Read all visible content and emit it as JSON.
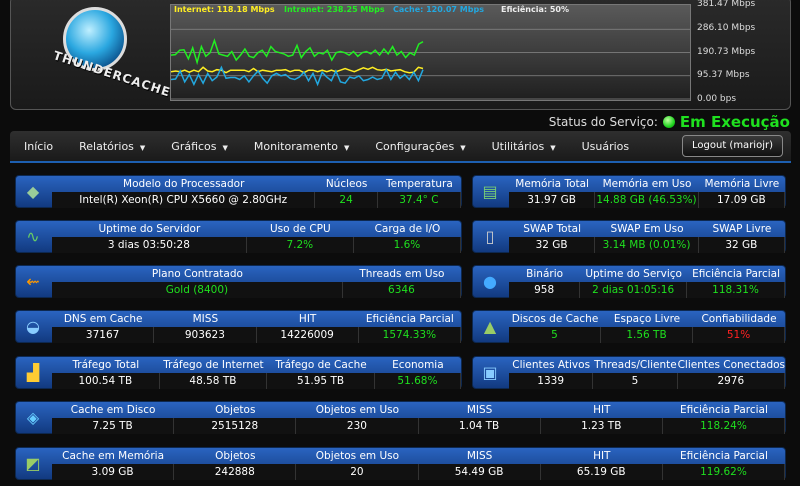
{
  "logo_text": "THUNDERCACHE",
  "chart_data": {
    "type": "line",
    "y_axis_labels": [
      "381.47 Mbps",
      "286.10 Mbps",
      "190.73 Mbps",
      "95.37 Mbps",
      "0.00 bps"
    ],
    "ylim": [
      0,
      381.47
    ],
    "legend": [
      {
        "label": "Internet: 118.18 Mbps",
        "color": "#ffee22"
      },
      {
        "label": "Intranet: 238.25 Mbps",
        "color": "#22ee22"
      },
      {
        "label": "Cache: 120.07 Mbps",
        "color": "#22a8e0"
      },
      {
        "label": "Eficiência: 50%",
        "color": "#eeeeee"
      }
    ],
    "series": [
      {
        "name": "Intranet",
        "color": "#22ee22",
        "values": [
          180,
          182,
          200,
          202,
          165,
          210,
          150,
          215,
          175,
          190,
          240,
          185,
          180,
          175,
          195,
          160,
          180,
          205,
          175,
          170,
          190,
          200,
          175,
          215,
          195,
          190,
          185,
          175,
          180,
          220,
          170,
          195,
          210,
          175,
          190,
          185,
          200,
          160,
          190,
          195,
          190,
          180,
          195,
          175,
          190,
          195,
          185,
          200,
          180,
          205,
          185,
          215,
          180,
          195,
          170,
          190,
          180,
          225,
          235
        ]
      },
      {
        "name": "Internet",
        "color": "#ffee22",
        "values": [
          112,
          115,
          112,
          118,
          110,
          118,
          112,
          130,
          115,
          112,
          120,
          118,
          108,
          118,
          118,
          118,
          118,
          112,
          125,
          112,
          118,
          115,
          112,
          118,
          118,
          120,
          112,
          118,
          118,
          108,
          118,
          118,
          112,
          118,
          112,
          118,
          112,
          118,
          125,
          118,
          112,
          120,
          128,
          122,
          130,
          120,
          118,
          122,
          115,
          118,
          120,
          112,
          108,
          110,
          130,
          125
        ]
      },
      {
        "name": "Cache",
        "color": "#22a8e0",
        "values": [
          80,
          82,
          115,
          70,
          100,
          60,
          100,
          65,
          105,
          75,
          90,
          130,
          85,
          88,
          88,
          80,
          95,
          70,
          95,
          115,
          85,
          65,
          95,
          105,
          95,
          100,
          85,
          80,
          90,
          110,
          75,
          105,
          60,
          110,
          90,
          75,
          115,
          70,
          65,
          90,
          85,
          95,
          75,
          80,
          90,
          80,
          85,
          120,
          80,
          110,
          85,
          100,
          80,
          110,
          75,
          120
        ]
      }
    ]
  },
  "status": {
    "label": "Status do Serviço:",
    "value": "Em Execução"
  },
  "nav": {
    "items": [
      "Início",
      "Relatórios",
      "Gráficos",
      "Monitoramento",
      "Configurações",
      "Utilitários",
      "Usuários"
    ],
    "logout": "Logout (mariojr)"
  },
  "panels": [
    {
      "icon": "◆",
      "cols": [
        {
          "h": "Modelo do Processador",
          "v": "Intel(R) Xeon(R) CPU X5660 @ 2.80GHz",
          "c": "w",
          "f": 3.8
        },
        {
          "h": "Núcleos",
          "v": "24",
          "c": "g",
          "f": 0.9
        },
        {
          "h": "Temperatura",
          "v": "37.4° C",
          "c": "g",
          "f": 1.2
        }
      ]
    },
    {
      "icon": "▤",
      "cols": [
        {
          "h": "Memória Total",
          "v": "31.97 GB",
          "c": "w",
          "f": 1
        },
        {
          "h": "Memória em Uso",
          "v": "14.88 GB (46.53%)",
          "c": "g",
          "f": 1.2
        },
        {
          "h": "Memória Livre",
          "v": "17.09 GB",
          "c": "w",
          "f": 1
        }
      ]
    },
    {
      "icon": "∿",
      "cols": [
        {
          "h": "Uptime do Servidor",
          "v": "3 dias 03:50:28",
          "c": "w",
          "f": 2
        },
        {
          "h": "Uso de CPU",
          "v": "7.2%",
          "c": "g",
          "f": 1.1
        },
        {
          "h": "Carga de I/O",
          "v": "1.6%",
          "c": "g",
          "f": 1.1
        }
      ]
    },
    {
      "icon": "▯",
      "cols": [
        {
          "h": "SWAP Total",
          "v": "32 GB",
          "c": "w",
          "f": 1
        },
        {
          "h": "SWAP Em Uso",
          "v": "3.14 MB (0.01%)",
          "c": "g",
          "f": 1.2
        },
        {
          "h": "SWAP Livre",
          "v": "32 GB",
          "c": "w",
          "f": 1
        }
      ]
    },
    {
      "icon": "⇜",
      "cols": [
        {
          "h": "Plano Contratado",
          "v": "Gold (8400)",
          "c": "g",
          "f": 3.2
        },
        {
          "h": "Threads em Uso",
          "v": "6346",
          "c": "g",
          "f": 1.3
        }
      ]
    },
    {
      "icon": "●",
      "cols": [
        {
          "h": "Binário",
          "v": "958",
          "c": "w",
          "f": 0.8
        },
        {
          "h": "Uptime do Serviço",
          "v": "2 dias 01:05:16",
          "c": "g",
          "f": 1.2
        },
        {
          "h": "Eficiência Parcial",
          "v": "118.31%",
          "c": "g",
          "f": 1.1
        }
      ]
    },
    {
      "icon": "◒",
      "cols": [
        {
          "h": "DNS em Cache",
          "v": "37167",
          "c": "w",
          "f": 1
        },
        {
          "h": "MISS",
          "v": "903623",
          "c": "w",
          "f": 1
        },
        {
          "h": "HIT",
          "v": "14226009",
          "c": "w",
          "f": 1
        },
        {
          "h": "Eficiência Parcial",
          "v": "1574.33%",
          "c": "g",
          "f": 1
        }
      ]
    },
    {
      "icon": "▲",
      "cols": [
        {
          "h": "Discos de Cache",
          "v": "5",
          "c": "g",
          "f": 1
        },
        {
          "h": "Espaço Livre",
          "v": "1.56 TB",
          "c": "g",
          "f": 1
        },
        {
          "h": "Confiabilidade",
          "v": "51%",
          "c": "r",
          "f": 1
        }
      ]
    },
    {
      "icon": "▟",
      "cols": [
        {
          "h": "Tráfego Total",
          "v": "100.54 TB",
          "c": "w",
          "f": 1
        },
        {
          "h": "Tráfego de Internet",
          "v": "48.58 TB",
          "c": "w",
          "f": 1
        },
        {
          "h": "Tráfego de Cache",
          "v": "51.95 TB",
          "c": "w",
          "f": 1
        },
        {
          "h": "Economia",
          "v": "51.68%",
          "c": "g",
          "f": 0.8
        }
      ]
    },
    {
      "icon": "▣",
      "cols": [
        {
          "h": "Clientes Ativos",
          "v": "1339",
          "c": "w",
          "f": 1
        },
        {
          "h": "Threads/Cliente",
          "v": "5",
          "c": "w",
          "f": 1
        },
        {
          "h": "Clientes Conectados",
          "v": "2976",
          "c": "w",
          "f": 1.2
        }
      ]
    },
    {
      "icon": "◈",
      "cols": [
        {
          "h": "Cache em Disco",
          "v": "7.25 TB",
          "c": "w",
          "f": 1
        },
        {
          "h": "Objetos",
          "v": "2515128",
          "c": "w",
          "f": 1
        },
        {
          "h": "Objetos em Uso",
          "v": "230",
          "c": "w",
          "f": 1
        },
        {
          "h": "MISS",
          "v": "1.04 TB",
          "c": "w",
          "f": 1
        },
        {
          "h": "HIT",
          "v": "1.23 TB",
          "c": "w",
          "f": 1
        },
        {
          "h": "Eficiência Parcial",
          "v": "118.24%",
          "c": "g",
          "f": 1
        }
      ]
    },
    {
      "icon": "◩",
      "cols": [
        {
          "h": "Cache em Memória",
          "v": "3.09 GB",
          "c": "w",
          "f": 1
        },
        {
          "h": "Objetos",
          "v": "242888",
          "c": "w",
          "f": 1
        },
        {
          "h": "Objetos em Uso",
          "v": "20",
          "c": "w",
          "f": 1
        },
        {
          "h": "MISS",
          "v": "54.49 GB",
          "c": "w",
          "f": 1
        },
        {
          "h": "HIT",
          "v": "65.19 GB",
          "c": "w",
          "f": 1
        },
        {
          "h": "Eficiência Parcial",
          "v": "119.62%",
          "c": "g",
          "f": 1
        }
      ]
    }
  ]
}
